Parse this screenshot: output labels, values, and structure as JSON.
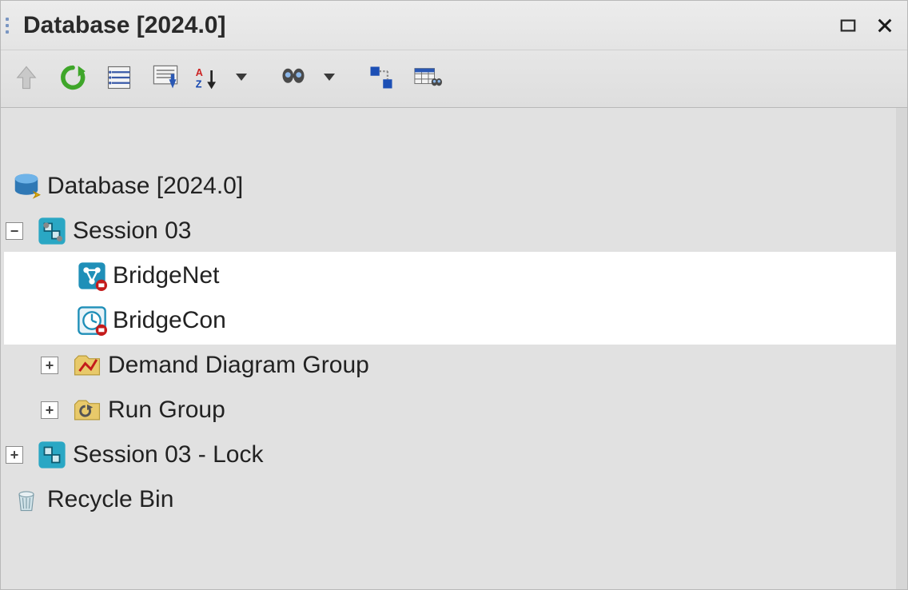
{
  "window": {
    "title": "Database [2024.0]"
  },
  "toolbar": {
    "up": "Up",
    "refresh": "Refresh",
    "list": "List",
    "download": "Download",
    "sort": "Sort A-Z",
    "find": "Find",
    "linked": "Linked",
    "gridfind": "Grid Find"
  },
  "tree": {
    "root": {
      "label": "Database [2024.0]"
    },
    "session": {
      "label": "Session 03",
      "expanded": true
    },
    "bridgenet": {
      "label": "BridgeNet"
    },
    "bridgecon": {
      "label": "BridgeCon"
    },
    "demand": {
      "label": "Demand Diagram Group",
      "expanded": false
    },
    "rungroup": {
      "label": "Run Group",
      "expanded": false
    },
    "sessionlock": {
      "label": "Session 03 - Lock",
      "expanded": false
    },
    "recycle": {
      "label": "Recycle Bin"
    }
  }
}
